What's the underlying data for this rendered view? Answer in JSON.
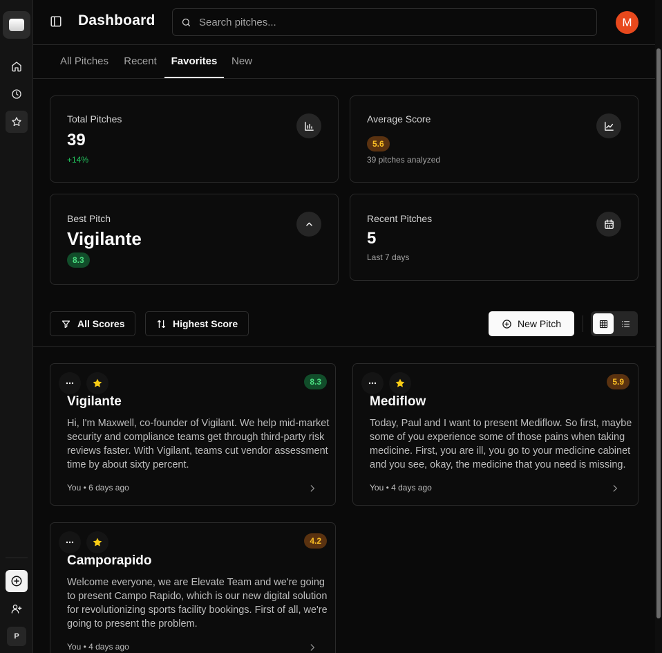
{
  "header": {
    "title": "Dashboard",
    "search_placeholder": "Search pitches...",
    "avatar_initial": "M"
  },
  "rail": {
    "workspace_initial": "P"
  },
  "tabs": [
    {
      "label": "All Pitches",
      "active": false
    },
    {
      "label": "Recent",
      "active": false
    },
    {
      "label": "Favorites",
      "active": true
    },
    {
      "label": "New",
      "active": false
    }
  ],
  "stats": {
    "total": {
      "label": "Total Pitches",
      "value": "39",
      "change": "+14%"
    },
    "average": {
      "label": "Average Score",
      "value": "5.6",
      "sub": "39 pitches analyzed"
    },
    "best": {
      "label": "Best Pitch",
      "value": "Vigilante",
      "score": "8.3"
    },
    "recent": {
      "label": "Recent Pitches",
      "value": "5",
      "sub": "Last 7 days"
    }
  },
  "toolbar": {
    "filter_label": "All Scores",
    "sort_label": "Highest Score",
    "new_label": "New Pitch",
    "view": "grid"
  },
  "pitches": [
    {
      "title": "Vigilante",
      "score": "8.3",
      "score_color": "green",
      "favorite": true,
      "description": "Hi, I'm Maxwell, co-founder of Vigilant. We help mid-market security and compliance teams get through third-party risk reviews faster. With Vigilant, teams cut vendor assessment time by about sixty percent.",
      "meta": "You • 6 days ago"
    },
    {
      "title": "Mediflow",
      "score": "5.9",
      "score_color": "amber",
      "favorite": true,
      "description": "Today, Paul and I want to present Mediflow. So first, maybe some of you experience some of those pains when taking medicine. First, you are ill, you go to your medicine cabinet and you see, okay, the medicine that you need is missing.",
      "meta": "You • 4 days ago"
    },
    {
      "title": "Camporapido",
      "score": "4.2",
      "score_color": "amber",
      "favorite": true,
      "description": "Welcome everyone, we are Elevate Team and we're going to present Campo Rapido, which is our new digital solution for revolutionizing sports facility bookings. First of all, we're going to present the problem.",
      "meta": "You • 4 days ago"
    }
  ]
}
